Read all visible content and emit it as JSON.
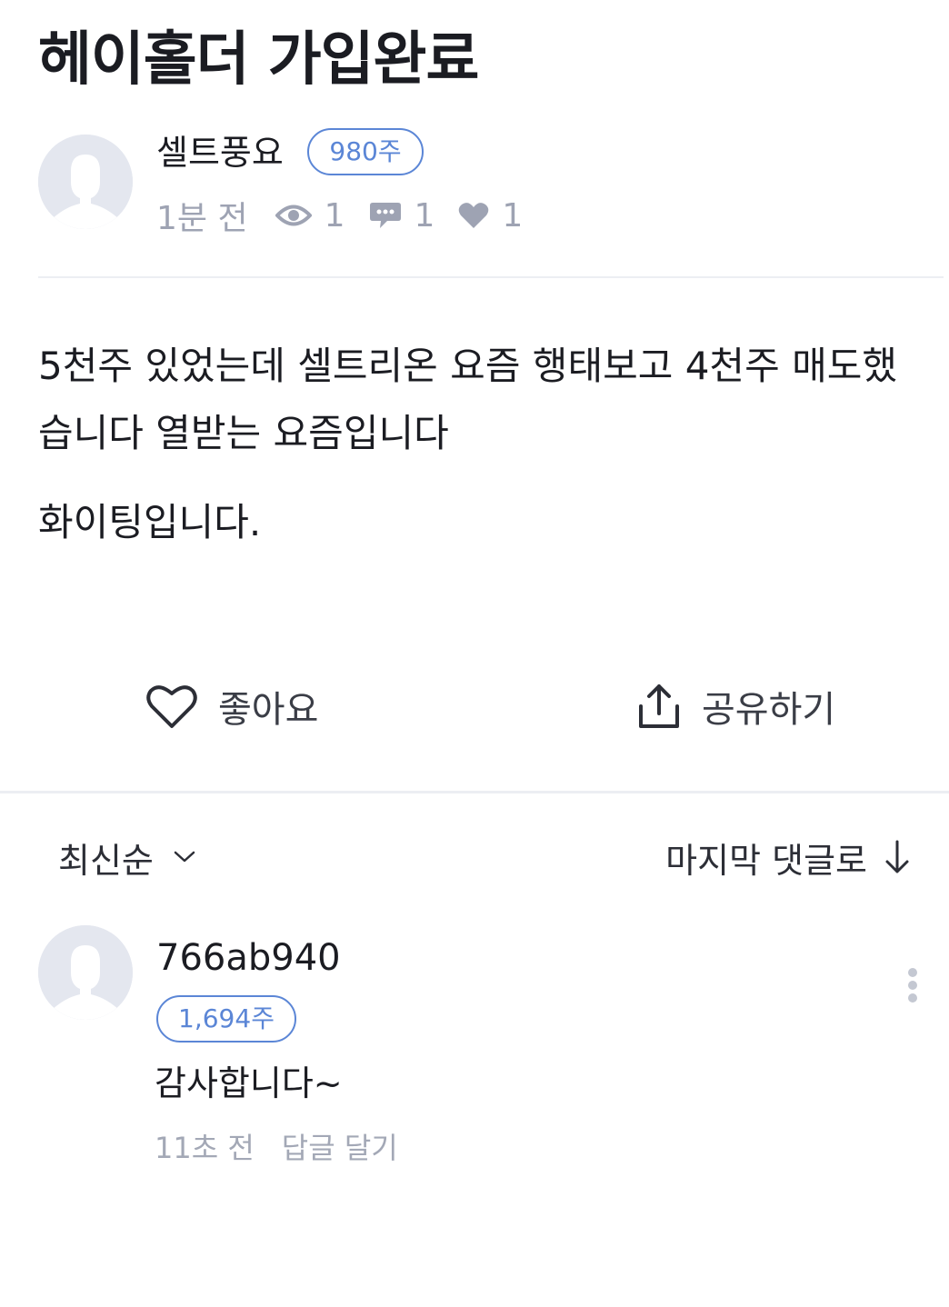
{
  "post": {
    "title": "헤이홀더 가입완료",
    "author": {
      "name": "셀트풍요",
      "badge": "980주"
    },
    "meta": {
      "time": "1분 전",
      "views": "1",
      "comments": "1",
      "likes": "1"
    },
    "body": {
      "paragraph1": "5천주 있었는데 셀트리온 요즘 행태보고 4천주 매도했습니다 열받는 요즘입니다",
      "paragraph2": "화이팅입니다."
    }
  },
  "actions": {
    "like_label": "좋아요",
    "share_label": "공유하기"
  },
  "comments_toolbar": {
    "sort_label": "최신순",
    "jump_label": "마지막 댓글로"
  },
  "comments": [
    {
      "user": "766ab940",
      "badge": "1,694주",
      "text": "감사합니다~",
      "time": "11초 전",
      "reply_label": "답글 달기"
    }
  ],
  "colors": {
    "accent": "#5b86d6",
    "muted": "#9ea3b3",
    "text": "#1b1c22",
    "divider": "#eceef3"
  },
  "icons": [
    "eye-icon",
    "comment-bubble-icon",
    "heart-filled-icon",
    "heart-outline-icon",
    "share-icon",
    "chevron-down-icon",
    "arrow-down-icon",
    "more-vertical-icon",
    "avatar-placeholder-icon"
  ]
}
